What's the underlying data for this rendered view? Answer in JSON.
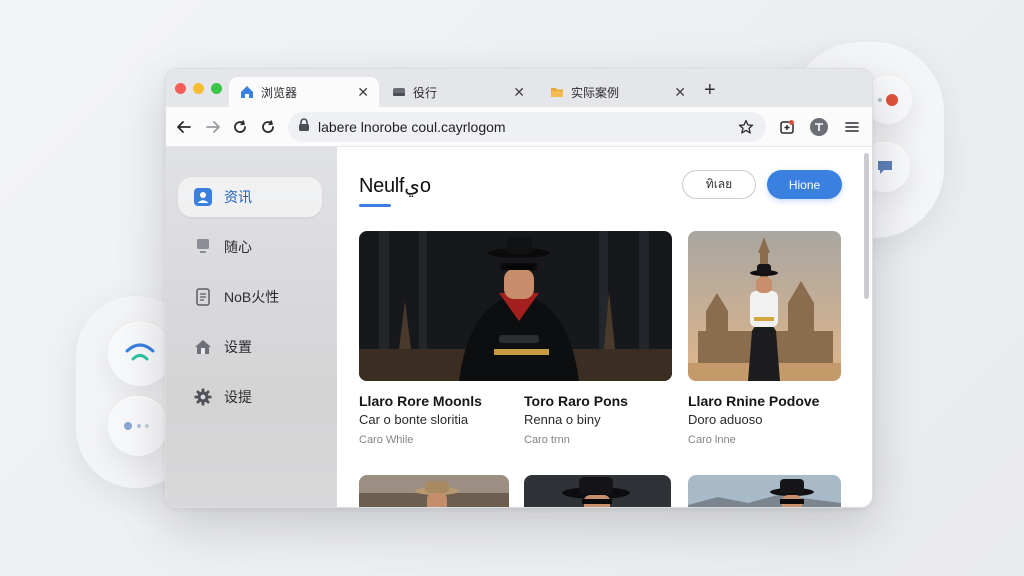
{
  "tabs": [
    {
      "label": "浏览器",
      "favicon": "home-icon",
      "active": true
    },
    {
      "label": "役行",
      "favicon": "drive-icon",
      "active": false
    },
    {
      "label": "实际案例",
      "favicon": "folder-icon",
      "active": false
    }
  ],
  "toolbar": {
    "url": "labere lnorobe coul.cayrlogom"
  },
  "sidebar": {
    "items": [
      {
        "label": "资讯",
        "icon": "user-icon",
        "active": true
      },
      {
        "label": "随心",
        "icon": "monitor-icon",
        "active": false
      },
      {
        "label": "NoB火性",
        "icon": "document-icon",
        "active": false
      },
      {
        "label": "设置",
        "icon": "home-icon",
        "active": false
      },
      {
        "label": "设提",
        "icon": "gear-icon",
        "active": false
      }
    ]
  },
  "main": {
    "title": "Neulfيo",
    "button_secondary": "ทิเลย",
    "button_primary": "Hione",
    "cards": [
      {
        "title": "Llaro Rore Moonls",
        "subtitle": "Car o bonte sloritia",
        "meta": "Caro While"
      },
      {
        "title": "Toro Raro Pons",
        "subtitle": "Renna o biny",
        "meta": "Caro trnn"
      },
      {
        "title": "Llaro Rnine Podove",
        "subtitle": "Doro aduoso",
        "meta": "Caro lnne"
      }
    ]
  },
  "colors": {
    "accent": "#3a80e0",
    "traffic_red": "#f25f58",
    "traffic_yellow": "#f8bd2e",
    "traffic_green": "#3bc549"
  }
}
